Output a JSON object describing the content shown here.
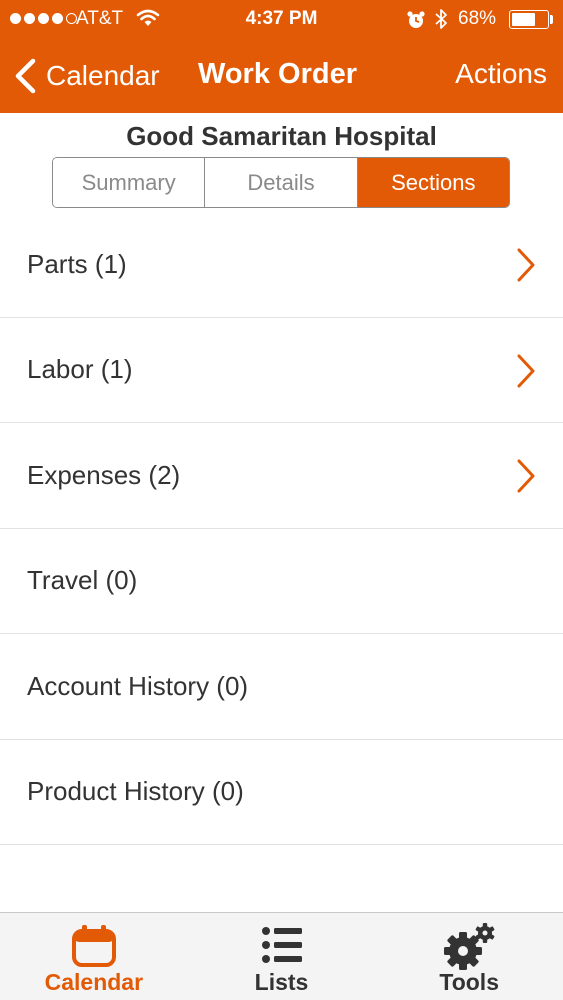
{
  "status_bar": {
    "carrier": "AT&T",
    "time": "4:37 PM",
    "battery_percent": "68%",
    "battery_level": 0.68,
    "signal_bars": 4,
    "icons": [
      "signal-icon",
      "wifi-icon",
      "alarm-icon",
      "bluetooth-icon",
      "battery-icon"
    ]
  },
  "nav": {
    "back_label": "Calendar",
    "title": "Work Order",
    "actions_label": "Actions"
  },
  "header": {
    "hospital": "Good Samaritan Hospital"
  },
  "segments": [
    {
      "label": "Summary",
      "active": false
    },
    {
      "label": "Details",
      "active": false
    },
    {
      "label": "Sections",
      "active": true
    }
  ],
  "sections": [
    {
      "label": "Parts (1)",
      "has_chevron": true
    },
    {
      "label": "Labor (1)",
      "has_chevron": true
    },
    {
      "label": "Expenses (2)",
      "has_chevron": true
    },
    {
      "label": "Travel (0)",
      "has_chevron": false
    },
    {
      "label": "Account History (0)",
      "has_chevron": false
    },
    {
      "label": "Product History (0)",
      "has_chevron": false
    }
  ],
  "tabs": [
    {
      "label": "Calendar",
      "icon": "calendar-icon",
      "active": true
    },
    {
      "label": "Lists",
      "icon": "list-icon",
      "active": false
    },
    {
      "label": "Tools",
      "icon": "gears-icon",
      "active": false
    }
  ],
  "colors": {
    "accent": "#E35A06",
    "text": "#333333",
    "divider": "#e2e2e2",
    "tab_bar_bg": "#f4f4f4"
  }
}
